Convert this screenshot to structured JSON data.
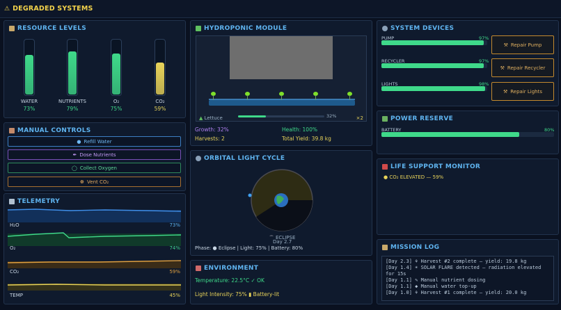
{
  "banner": {
    "icon": "warning-icon",
    "title": "DEGRADED SYSTEMS",
    "color": "#f2d24b"
  },
  "resources": {
    "title": "RESOURCE LEVELS",
    "gauges": [
      {
        "name": "WATER",
        "pct_label": "73%",
        "level": 0.73,
        "color": "#3fd98a"
      },
      {
        "name": "NUTRIENTS",
        "pct_label": "79%",
        "level": 0.79,
        "color": "#3fd98a"
      },
      {
        "name": "O₂",
        "pct_label": "75%",
        "level": 0.75,
        "color": "#3fd98a"
      },
      {
        "name": "CO₂",
        "pct_label": "59%",
        "level": 0.59,
        "color": "#e8d35a"
      }
    ]
  },
  "controls": {
    "title": "MANUAL CONTROLS",
    "buttons": [
      {
        "label": "Refill Water",
        "icon": "droplet-icon",
        "color": "#58b0f0"
      },
      {
        "label": "Dose Nutrients",
        "icon": "syringe-icon",
        "color": "#b080f0"
      },
      {
        "label": "Collect Oxygen",
        "icon": "oxygen-icon",
        "color": "#3fd98a"
      },
      {
        "label": "Vent CO₂",
        "icon": "vent-icon",
        "color": "#e0a050"
      }
    ]
  },
  "telemetry": {
    "title": "TELEMETRY",
    "series": [
      {
        "name": "H₂O",
        "pct_label": "73%",
        "color": "#3f8ee8"
      },
      {
        "name": "O₂",
        "pct_label": "74%",
        "color": "#3fd98a"
      },
      {
        "name": "CO₂",
        "pct_label": "59%",
        "color": "#e0a040"
      },
      {
        "name": "TEMP",
        "pct_label": "45%",
        "color": "#e8d35a"
      }
    ]
  },
  "hydro": {
    "title": "HYDROPONIC MODULE",
    "crop": "Lettuce",
    "growth_bar": 0.32,
    "growth_bar_label": "32%",
    "multiplier": "×2",
    "growth": "Growth: 32%",
    "health": "Health: 100%",
    "harvests": "Harvests: 2",
    "total_yield": "Total Yield: 39.8 kg"
  },
  "orbit": {
    "title": "ORBITAL LIGHT CYCLE",
    "phase_name": "ECLIPSE",
    "day": "Day 2.7",
    "status": "Phase: ● Eclipse  |  Light: 75%  |  Battery: 80%"
  },
  "environment": {
    "title": "ENVIRONMENT",
    "temperature": "Temperature: 22.5°C  ✓ OK",
    "light": "Light Intensity: 75%  ▮ Battery-lit"
  },
  "devices": {
    "title": "SYSTEM DEVICES",
    "items": [
      {
        "name": "PUMP",
        "pct_label": "97%",
        "level": 0.97,
        "repair_label": "Repair Pump"
      },
      {
        "name": "RECYCLER",
        "pct_label": "97%",
        "level": 0.97,
        "repair_label": "Repair Recycler"
      },
      {
        "name": "LIGHTS",
        "pct_label": "98%",
        "level": 0.98,
        "repair_label": "Repair Lights"
      }
    ]
  },
  "power": {
    "title": "POWER RESERVE",
    "battery_name": "BATTERY",
    "battery_pct_label": "80%",
    "battery_level": 0.8
  },
  "life_support": {
    "title": "LIFE SUPPORT MONITOR",
    "alert": "● CO₂ ELEVATED — 59%"
  },
  "mission_log": {
    "title": "MISSION LOG",
    "entries": [
      "[Day 2.3] ⚘ Harvest #2 complete — yield: 19.8 kg",
      "[Day 1.4] ☀ SOLAR FLARE detected — radiation elevated for 15s",
      "[Day 1.1] ✎ Manual nutrient dosing",
      "[Day 1.1] ◆ Manual water top-up",
      "[Day 1.0] ⚘ Harvest #1 complete — yield: 20.0 kg"
    ]
  }
}
